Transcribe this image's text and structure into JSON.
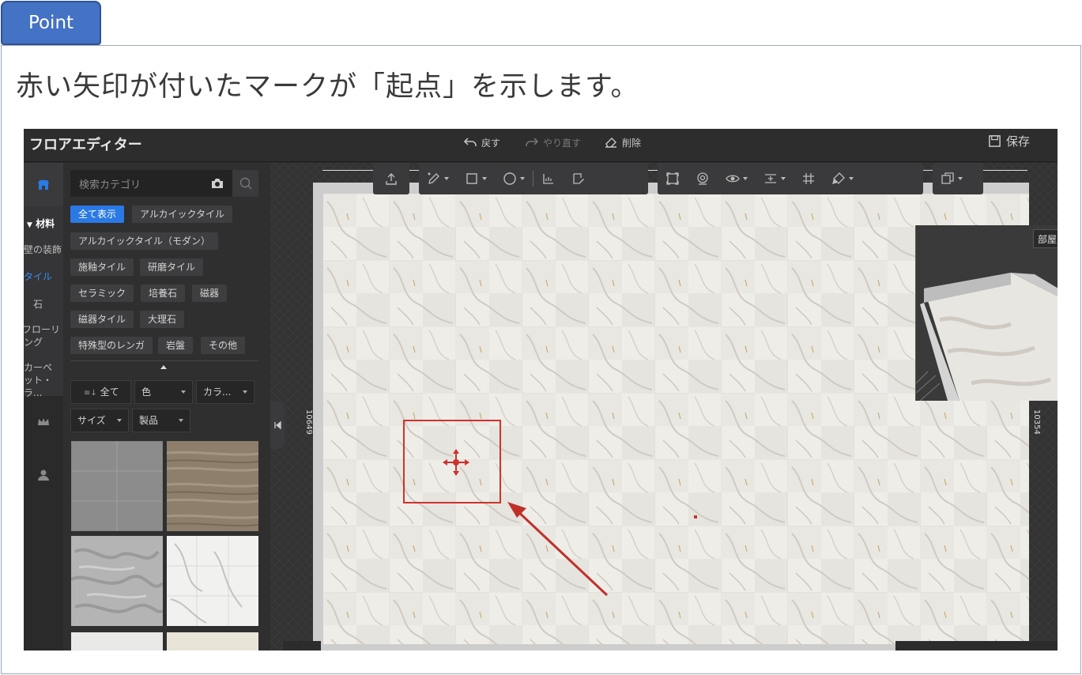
{
  "point_label": "Point",
  "heading": "赤い矢印が付いたマークが「起点」を示します。",
  "colors": {
    "accent_red": "#d0312d",
    "point_blue": "#4472c4",
    "chip_active": "#2a79e4"
  },
  "app": {
    "title": "フロアエディター",
    "toolbar": {
      "undo": "戻す",
      "redo": "やり直す",
      "delete": "削除",
      "save": "保存"
    }
  },
  "subnav": [
    {
      "label": "材料"
    },
    {
      "label": "壁の装飾"
    },
    {
      "label": "タイル"
    },
    {
      "label": "石"
    },
    {
      "label": "フローリング"
    },
    {
      "label": "カーペット・ラ..."
    }
  ],
  "search": {
    "placeholder": "検索カテゴリ"
  },
  "chips": [
    "全て表示",
    "アルカイックタイル",
    "アルカイックタイル（モダン）",
    "施釉タイル",
    "研磨タイル",
    "セラミック",
    "培養石",
    "磁器",
    "磁器タイル",
    "大理石",
    "特殊型のレンガ",
    "岩盤",
    "その他"
  ],
  "filters": {
    "all": "全て",
    "color": "色",
    "collar": "カラ...",
    "size": "サイズ",
    "product": "製品"
  },
  "canvas": {
    "dim_left": "10649",
    "dim_right": "10354",
    "room_tag": "部屋"
  },
  "icons": [
    "undo-icon",
    "redo-icon",
    "eraser-icon",
    "save-icon",
    "camera-icon",
    "search-icon",
    "crown-icon",
    "user-icon",
    "store-icon",
    "origin-marker-icon"
  ]
}
